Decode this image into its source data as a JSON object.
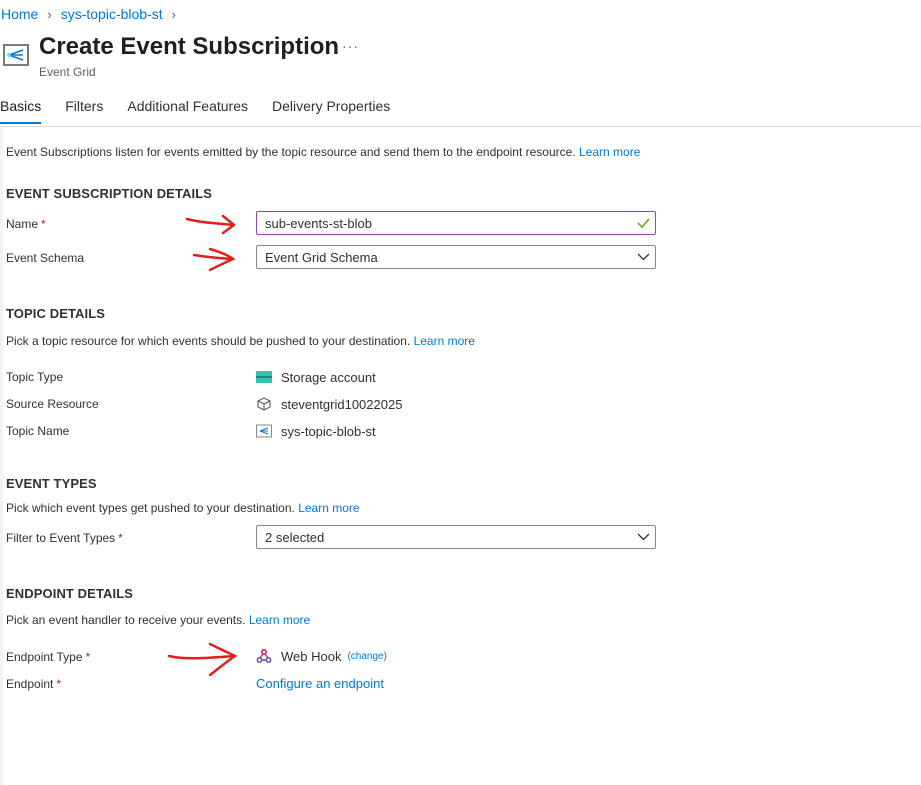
{
  "breadcrumb": {
    "items": [
      "Home",
      "sys-topic-blob-st"
    ]
  },
  "header": {
    "title": "Create Event Subscription",
    "subtitle": "Event Grid",
    "more": "···"
  },
  "tabs": [
    {
      "label": "Basics",
      "active": true
    },
    {
      "label": "Filters",
      "active": false
    },
    {
      "label": "Additional Features",
      "active": false
    },
    {
      "label": "Delivery Properties",
      "active": false
    }
  ],
  "intro": {
    "text": "Event Subscriptions listen for events emitted by the topic resource and send them to the endpoint resource.",
    "link": "Learn more"
  },
  "subscription": {
    "title": "EVENT SUBSCRIPTION DETAILS",
    "name_label": "Name",
    "name_value": "sub-events-st-blob",
    "schema_label": "Event Schema",
    "schema_value": "Event Grid Schema"
  },
  "topic": {
    "title": "TOPIC DETAILS",
    "desc": "Pick a topic resource for which events should be pushed to your destination.",
    "link": "Learn more",
    "type_label": "Topic Type",
    "type_value": "Storage account",
    "source_label": "Source Resource",
    "source_value": "steventgrid10022025",
    "name_label": "Topic Name",
    "name_value": "sys-topic-blob-st"
  },
  "event_types": {
    "title": "EVENT TYPES",
    "desc": "Pick which event types get pushed to your destination.",
    "link": "Learn more",
    "filter_label": "Filter to Event Types",
    "filter_value": "2 selected"
  },
  "endpoint": {
    "title": "ENDPOINT DETAILS",
    "desc": "Pick an event handler to receive your events.",
    "link": "Learn more",
    "type_label": "Endpoint Type",
    "type_value": "Web Hook",
    "change_link": "(change)",
    "endpoint_label": "Endpoint",
    "configure_link": "Configure an endpoint"
  },
  "required_marker": "*",
  "colors": {
    "accent": "#0078d4",
    "required": "#a4262c",
    "annotation": "#e0201e",
    "valid": "#57a300"
  }
}
